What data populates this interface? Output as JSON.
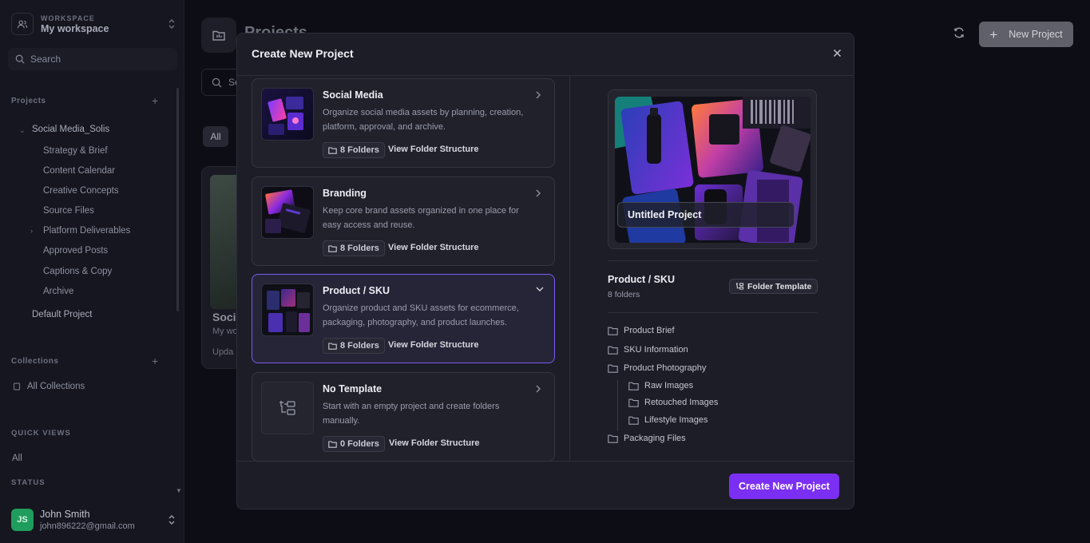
{
  "sidebar": {
    "workspace_label": "WORKSPACE",
    "workspace_name": "My workspace",
    "search_placeholder": "Search",
    "projects_title": "Projects",
    "project_root": "Social Media_Solis",
    "project_children": [
      "Strategy & Brief",
      "Content Calendar",
      "Creative Concepts",
      "Source Files",
      "Platform Deliverables",
      "Approved Posts",
      "Captions & Copy",
      "Archive"
    ],
    "default_project": "Default Project",
    "collections_title": "Collections",
    "all_collections": "All Collections",
    "quick_views_title": "QUICK VIEWS",
    "quick_all": "All",
    "status_title": "STATUS",
    "user": {
      "initials": "JS",
      "name": "John Smith",
      "email": "john896222@gmail.com"
    }
  },
  "main": {
    "page_title": "Projects",
    "search_placeholder": "Se",
    "filter_all": "All",
    "new_project_label": "New Project",
    "bg_card": {
      "title": "Soci",
      "subtitle": "My wo",
      "updated": "Upda"
    }
  },
  "modal": {
    "title": "Create New Project",
    "templates": [
      {
        "name": "Social Media",
        "desc": "Organize social media assets by planning, creation, platform, approval, and archive.",
        "folders": "8 Folders",
        "link": "View Folder Structure",
        "selected": false
      },
      {
        "name": "Branding",
        "desc": "Keep core brand assets organized in one place for easy access and reuse.",
        "folders": "8 Folders",
        "link": "View Folder Structure",
        "selected": false
      },
      {
        "name": "Product / SKU",
        "desc": "Organize product and SKU assets for ecommerce, packaging, photography, and product launches.",
        "folders": "8 Folders",
        "link": "View Folder Structure",
        "selected": true
      },
      {
        "name": "No Template",
        "desc": "Start with an empty project and create folders manually.",
        "folders": "0 Folders",
        "link": "View Folder Structure",
        "selected": false
      }
    ],
    "preview": {
      "project_name": "Untitled Project",
      "template_name": "Product / SKU",
      "folder_count": "8 folders",
      "badge": "Folder Template",
      "folders": [
        {
          "name": "Product Brief",
          "level": 0
        },
        {
          "name": "SKU Information",
          "level": 0
        },
        {
          "name": "Product Photography",
          "level": 0
        },
        {
          "name": "Raw Images",
          "level": 1
        },
        {
          "name": "Retouched Images",
          "level": 1
        },
        {
          "name": "Lifestyle Images",
          "level": 1
        },
        {
          "name": "Packaging Files",
          "level": 0
        }
      ]
    },
    "create_button": "Create New Project"
  },
  "colors": {
    "accent": "#7b2ff2",
    "selected_border": "#7c5af0",
    "avatar": "#1f9d5c"
  }
}
